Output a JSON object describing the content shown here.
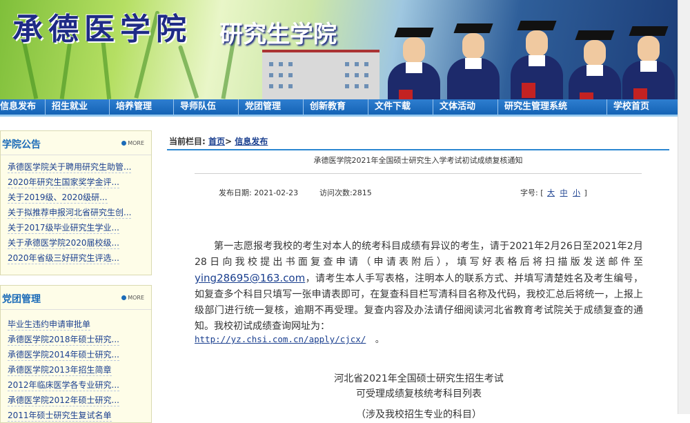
{
  "banner": {
    "title_main": "承德医学院",
    "title_sub": "研究生学院"
  },
  "nav": {
    "items": [
      "信息发布",
      "招生就业",
      "培养管理",
      "导师队伍",
      "党团管理",
      "创新教育",
      "文件下载",
      "文体活动",
      "研究生管理系统",
      "学校首页"
    ]
  },
  "sidebar": {
    "notice": {
      "title": "学院公告",
      "more": "MORE",
      "items": [
        "承德医学院关于聘用研究生助管...",
        "2020年研究生国家奖学金评...",
        "关于2019级、2020级研...",
        "关于拟推荐申报河北省研究生创...",
        "关于2017级毕业研究生学业...",
        "关于承德医学院2020届校级...",
        "2020年省级三好研究生评选..."
      ]
    },
    "party": {
      "title": "党团管理",
      "more": "MORE",
      "items": [
        "毕业生违约申请审批单",
        "承德医学院2018年硕士研究...",
        "承德医学院2014年硕士研究...",
        "承德医学院2013年招生简章",
        "2012年临床医学各专业研究...",
        "承德医学院2012年硕士研究...",
        "2011年硕士研究生复试名单"
      ]
    }
  },
  "article": {
    "crumb_label": "当前栏目:",
    "crumb_home": "首页",
    "crumb_sep": ">",
    "crumb_section": "信息发布",
    "title": "承德医学院2021年全国硕士研究生入学考试初试成绩复核通知",
    "date_label": "发布日期:",
    "date": "2021-02-23",
    "visits_label": "访问次数:",
    "visits": "2815",
    "fontsize_label": "字号:",
    "fontsize_open": "[",
    "fontsize_large": "大",
    "fontsize_medium": "中",
    "fontsize_small": "小",
    "fontsize_close": "]",
    "para_part1": "第一志愿报考我校的考生对本人的统考科目成绩有异议的考生，请于2021年2月26日至2021年2月28日向我校提出书面复查申请（申请表附后），填写好表格后将扫描版发送邮件至",
    "email": "ying28695@163.com",
    "para_part2": "，请考生本人手写表格，注明本人的联系方式、并填写清楚姓名及考生编号，如复查多个科目只填写一张申请表即可，在复查科目栏写清科目名称及代码，我校汇总后将统一，上报上级部门进行统一复核，逾期不再受理。复查内容及办法请仔细阅读河北省教育考试院关于成绩复查的通知。我校初试成绩查询网址为：",
    "url": "http://yz.chsi.com.cn/apply/cjcx/",
    "url_suffix": "。",
    "sub_title_1": "河北省2021年全国硕士研究生招生考试",
    "sub_title_2": "可受理成绩复核统考科目列表",
    "sub_title_3": "（涉及我校招生专业的科目）"
  }
}
